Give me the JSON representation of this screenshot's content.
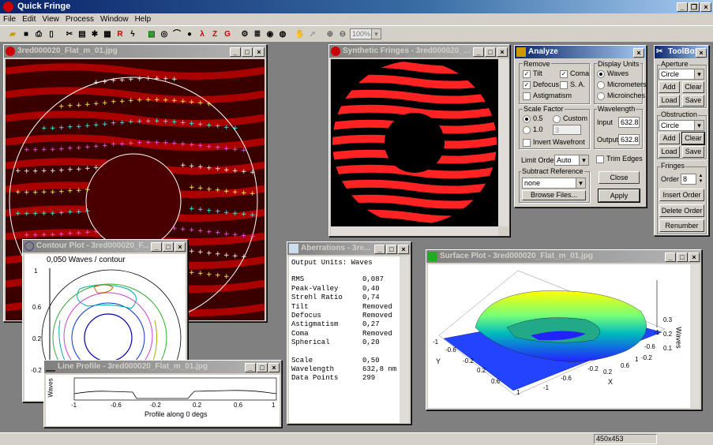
{
  "app": {
    "title": "Quick Fringe",
    "menu": [
      "File",
      "Edit",
      "View",
      "Process",
      "Window",
      "Help"
    ],
    "zoom": "100%",
    "status": "450x453"
  },
  "windows": {
    "image": {
      "title": "3red000020_Flat_m_01.jpg"
    },
    "synthetic": {
      "title": "Synthetic Fringes - 3red000020_..."
    },
    "contour": {
      "title": "Contour Plot - 3red000020_F...",
      "subtitle": "0,050 Waves / contour"
    },
    "profile": {
      "title": "Line Profile - 3red000020_Flat_m_01.jpg",
      "xlabel": "Profile along 0 degs",
      "ylabel": "Waves",
      "xticks": [
        "-1",
        "-0.6",
        "-0.2",
        "0.2",
        "0.6",
        "1"
      ]
    },
    "aberr": {
      "title": "Aberrations - 3re...",
      "header": "Output Units: Waves",
      "rows": [
        [
          "RMS",
          "0,087"
        ],
        [
          "Peak-Valley",
          "0,40"
        ],
        [
          "Strehl Ratio",
          "0,74"
        ],
        [
          "Tilt",
          "Removed"
        ],
        [
          "Defocus",
          "Removed"
        ],
        [
          "Astigmatism",
          "0,27"
        ],
        [
          "Coma",
          "Removed"
        ],
        [
          "Spherical",
          "0,20"
        ]
      ],
      "rows2": [
        [
          "Scale",
          "0,50"
        ],
        [
          "Wavelength",
          "632,8 nm"
        ],
        [
          "Data Points",
          "299"
        ]
      ]
    },
    "surface": {
      "title": "Surface Plot - 3red000020_Flat_m_01.jpg",
      "zlabel": "Waves",
      "xlabel": "X",
      "ylabel": "Y",
      "zticks": [
        "0.3",
        "0.2",
        "0.1"
      ],
      "xticks": [
        "-1",
        "-0.6",
        "-0.2",
        "0.2",
        "0.6",
        "1"
      ],
      "yticks": [
        "-1",
        "-0.6",
        "-0.2",
        "0.2",
        "0.6",
        "1"
      ],
      "rticks": [
        "-0.2",
        "-0.6",
        "-1"
      ]
    },
    "analyze": {
      "title": "Analyze",
      "remove": "Remove",
      "tilt": "Tilt",
      "coma": "Coma",
      "defocus": "Defocus",
      "sa": "S. A.",
      "astig": "Astigmatism",
      "display": "Display Units",
      "waves": "Waves",
      "micrometers": "Micrometers",
      "microinches": "Microinches",
      "scale": "Scale Factor",
      "s05": "0.5",
      "custom": "Custom",
      "s10": "1.0",
      "customval": "3",
      "invert": "Invert Wavefront",
      "wavelength": "Wavelength",
      "input": "Input",
      "inputval": "632.8",
      "output": "Output",
      "outputval": "632.8",
      "limit": "Limit Order",
      "limitval": "Auto",
      "trim": "Trim Edges",
      "subtract": "Subtract Reference",
      "subval": "none",
      "browse": "Browse Files...",
      "close": "Close",
      "apply": "Apply"
    },
    "toolbox": {
      "title": "ToolBox",
      "aperture": "Aperture",
      "apval": "Circle",
      "add": "Add",
      "clear": "Clear",
      "load": "Load",
      "save": "Save",
      "obstruction": "Obstruction",
      "obval": "Circle",
      "fringes": "Fringes",
      "order": "Order",
      "orderval": "8",
      "insert": "Insert Order",
      "delete": "Delete Order",
      "renumber": "Renumber"
    }
  },
  "colors": {
    "fringe": "#ff2020",
    "bg": "#808080",
    "dots": [
      "#ffffff",
      "#ffff60",
      "#40ffff",
      "#ff60ff"
    ]
  }
}
